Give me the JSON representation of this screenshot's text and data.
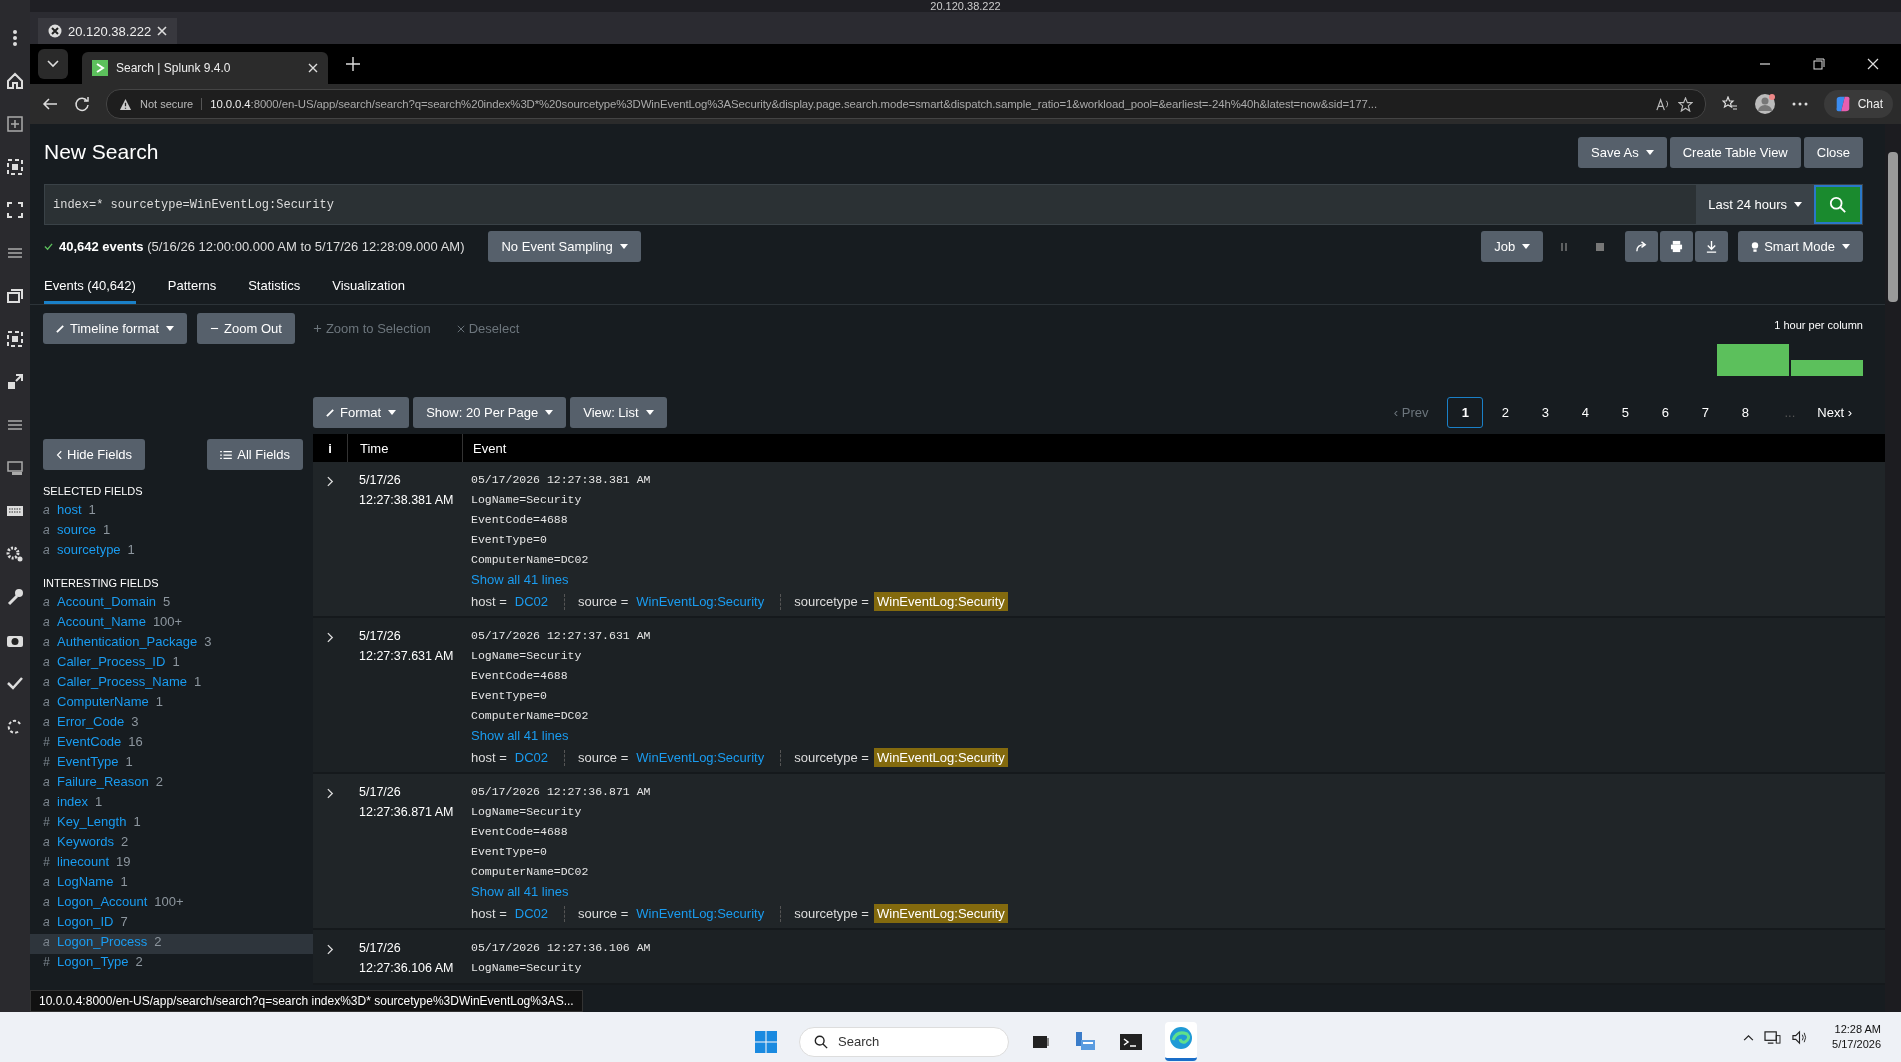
{
  "remote": {
    "title": "20.120.38.222",
    "tab": "20.120.38.222"
  },
  "browser": {
    "tabs": [
      {
        "title": "Search | Splunk 9.4.0",
        "selected": true
      }
    ],
    "security": "Not secure",
    "url_host": "10.0.0.4",
    "url_rest": ":8000/en-US/app/search/search?q=search%20index%3D*%20sourcetype%3DWinEventLog%3ASecurity&display.page.search.mode=smart&dispatch.sample_ratio=1&workload_pool=&earliest=-24h%40h&latest=now&sid=177...",
    "chat": "Chat"
  },
  "page": {
    "title": "New Search",
    "header_buttons": [
      {
        "label": "Save As",
        "dropdown": true
      },
      {
        "label": "Create Table View",
        "dropdown": false
      },
      {
        "label": "Close",
        "dropdown": false
      }
    ]
  },
  "search": {
    "query": "index=* sourcetype=WinEventLog:Security",
    "time_range": "Last 24 hours"
  },
  "summary": {
    "count": "40,642 events",
    "range": "(5/16/26 12:00:00.000 AM to 5/17/26 12:28:09.000 AM)",
    "sampling": "No Event Sampling"
  },
  "job": {
    "label": "Job",
    "mode": "Smart Mode"
  },
  "tabs": [
    {
      "label": "Events (40,642)",
      "selected": true
    },
    {
      "label": "Patterns",
      "selected": false
    },
    {
      "label": "Statistics",
      "selected": false
    },
    {
      "label": "Visualization",
      "selected": false
    }
  ],
  "timeline": {
    "buttons": [
      {
        "label": "Timeline format",
        "dropdown": true,
        "disabled": false
      },
      {
        "label": "Zoom Out",
        "dropdown": false,
        "disabled": false
      },
      {
        "label": "Zoom to Selection",
        "dropdown": false,
        "disabled": true
      },
      {
        "label": "Deselect",
        "dropdown": false,
        "disabled": true
      }
    ],
    "scale": "1 hour per column"
  },
  "results_toolbar": [
    {
      "label": "Format"
    },
    {
      "label": "Show: 20 Per Page"
    },
    {
      "label": "View: List"
    }
  ],
  "pagination": {
    "prev": "‹ Prev",
    "pages": [
      {
        "label": "1",
        "selected": true
      },
      {
        "label": "2",
        "selected": false
      },
      {
        "label": "3",
        "selected": false
      },
      {
        "label": "4",
        "selected": false
      },
      {
        "label": "5",
        "selected": false
      },
      {
        "label": "6",
        "selected": false
      },
      {
        "label": "7",
        "selected": false
      },
      {
        "label": "8",
        "selected": false
      }
    ],
    "ellipsis": "...",
    "next": "Next ›"
  },
  "sidebar": {
    "hide": "Hide Fields",
    "all": "All Fields",
    "sections": [
      {
        "title": "SELECTED FIELDS",
        "fields": [
          {
            "type": "a",
            "name": "host",
            "count": "1",
            "selected": false
          },
          {
            "type": "a",
            "name": "source",
            "count": "1",
            "selected": false
          },
          {
            "type": "a",
            "name": "sourcetype",
            "count": "1",
            "selected": false
          }
        ]
      },
      {
        "title": "INTERESTING FIELDS",
        "fields": [
          {
            "type": "a",
            "name": "Account_Domain",
            "count": "5",
            "selected": false
          },
          {
            "type": "a",
            "name": "Account_Name",
            "count": "100+",
            "selected": false
          },
          {
            "type": "a",
            "name": "Authentication_Package",
            "count": "3",
            "selected": false
          },
          {
            "type": "a",
            "name": "Caller_Process_ID",
            "count": "1",
            "selected": false
          },
          {
            "type": "a",
            "name": "Caller_Process_Name",
            "count": "1",
            "selected": false
          },
          {
            "type": "a",
            "name": "ComputerName",
            "count": "1",
            "selected": false
          },
          {
            "type": "a",
            "name": "Error_Code",
            "count": "3",
            "selected": false
          },
          {
            "type": "#",
            "name": "EventCode",
            "count": "16",
            "selected": false
          },
          {
            "type": "#",
            "name": "EventType",
            "count": "1",
            "selected": false
          },
          {
            "type": "a",
            "name": "Failure_Reason",
            "count": "2",
            "selected": false
          },
          {
            "type": "a",
            "name": "index",
            "count": "1",
            "selected": false
          },
          {
            "type": "#",
            "name": "Key_Length",
            "count": "1",
            "selected": false
          },
          {
            "type": "a",
            "name": "Keywords",
            "count": "2",
            "selected": false
          },
          {
            "type": "#",
            "name": "linecount",
            "count": "19",
            "selected": false
          },
          {
            "type": "a",
            "name": "LogName",
            "count": "1",
            "selected": false
          },
          {
            "type": "a",
            "name": "Logon_Account",
            "count": "100+",
            "selected": false
          },
          {
            "type": "a",
            "name": "Logon_ID",
            "count": "7",
            "selected": false
          },
          {
            "type": "a",
            "name": "Logon_Process",
            "count": "2",
            "selected": true
          },
          {
            "type": "#",
            "name": "Logon_Type",
            "count": "2",
            "selected": false
          }
        ]
      }
    ]
  },
  "table": {
    "columns": [
      "i",
      "Time",
      "Event"
    ],
    "rows": [
      {
        "date": "5/17/26",
        "time": "12:27:38.381 AM",
        "lines": [
          "05/17/2026 12:27:38.381 AM",
          "LogName=Security",
          "EventCode=4688",
          "EventType=0",
          "ComputerName=DC02"
        ],
        "show_all": "Show all 41 lines",
        "fields": [
          {
            "key": "host =",
            "value": "DC02",
            "highlighted": false
          },
          {
            "key": "source =",
            "value": "WinEventLog:Security",
            "highlighted": false
          },
          {
            "key": "sourcetype =",
            "value": "WinEventLog:Security",
            "highlighted": true
          }
        ]
      },
      {
        "date": "5/17/26",
        "time": "12:27:37.631 AM",
        "lines": [
          "05/17/2026 12:27:37.631 AM",
          "LogName=Security",
          "EventCode=4688",
          "EventType=0",
          "ComputerName=DC02"
        ],
        "show_all": "Show all 41 lines",
        "fields": [
          {
            "key": "host =",
            "value": "DC02",
            "highlighted": false
          },
          {
            "key": "source =",
            "value": "WinEventLog:Security",
            "highlighted": false
          },
          {
            "key": "sourcetype =",
            "value": "WinEventLog:Security",
            "highlighted": true
          }
        ]
      },
      {
        "date": "5/17/26",
        "time": "12:27:36.871 AM",
        "lines": [
          "05/17/2026 12:27:36.871 AM",
          "LogName=Security",
          "EventCode=4688",
          "EventType=0",
          "ComputerName=DC02"
        ],
        "show_all": "Show all 41 lines",
        "fields": [
          {
            "key": "host =",
            "value": "DC02",
            "highlighted": false
          },
          {
            "key": "source =",
            "value": "WinEventLog:Security",
            "highlighted": false
          },
          {
            "key": "sourcetype =",
            "value": "WinEventLog:Security",
            "highlighted": true
          }
        ]
      },
      {
        "date": "5/17/26",
        "time": "12:27:36.106 AM",
        "lines": [
          "05/17/2026 12:27:36.106 AM",
          "LogName=Security"
        ]
      }
    ]
  },
  "status_url": "10.0.0.4:8000/en-US/app/search/search?q=search index%3D* sourcetype%3DWinEventLog%3AS...",
  "taskbar": {
    "search": "Search",
    "time": "12:28 AM",
    "date": "5/17/2026"
  }
}
